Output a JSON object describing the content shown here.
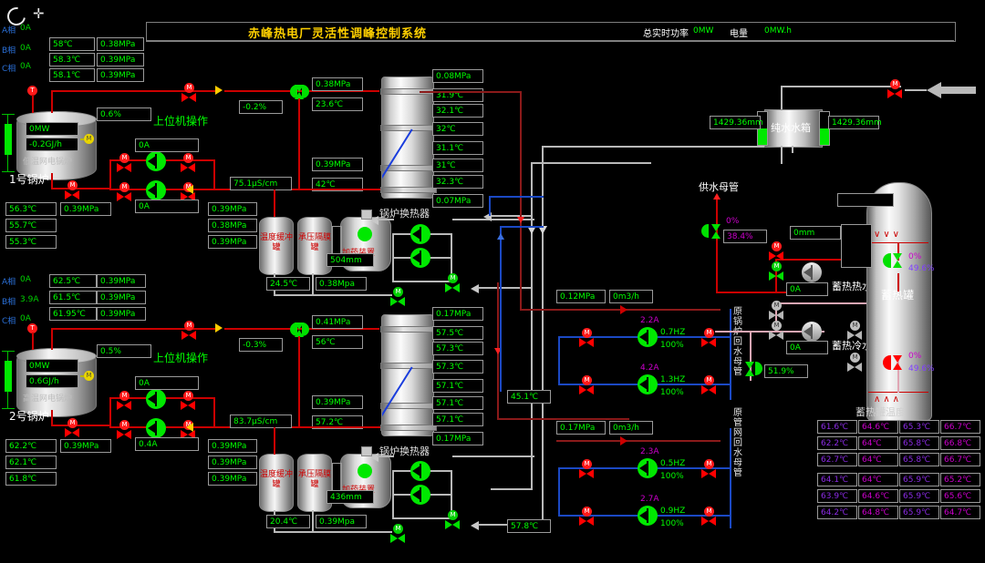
{
  "header": {
    "title": "赤峰热电厂灵活性调峰控制系统",
    "power_label": "总实时功率",
    "power_value": "0MW",
    "energy_label": "电量",
    "energy_value": "0MW.h"
  },
  "cursor": {
    "refresh_icon": "refresh-cursor",
    "move_icon": "move-cursor"
  },
  "boiler1": {
    "name": "1号锅炉",
    "type_label": "低温网电锅炉",
    "power": "0MW",
    "heat_rate": "-0.2GJ/h",
    "opening": "0.6%",
    "host_label": "上位机操作",
    "phases": [
      {
        "label": "A相",
        "current": "0A"
      },
      {
        "label": "B相",
        "current": "0A"
      },
      {
        "label": "C相",
        "current": "0A"
      }
    ],
    "top_temps": [
      "58℃",
      "58.3℃",
      "58.1℃"
    ],
    "top_press": [
      "0.38MPa",
      "0.39MPa",
      "0.39MPa"
    ],
    "bot_temps": [
      "56.3℃",
      "55.7℃",
      "55.3℃"
    ],
    "bot_press": [
      "0.39MPa"
    ],
    "pump_currents": [
      "0A",
      "0A"
    ]
  },
  "boiler2": {
    "name": "2号锅炉",
    "type_label": "高温网电锅炉",
    "power": "0MW",
    "heat_rate": "0.6GJ/h",
    "opening": "0.5%",
    "host_label": "上位机操作",
    "phases": [
      {
        "label": "A相",
        "current": "0A"
      },
      {
        "label": "B相",
        "current": "3.9A"
      },
      {
        "label": "C相",
        "current": "0A"
      }
    ],
    "top_temps": [
      "62.5℃",
      "61.5℃",
      "61.95℃"
    ],
    "top_press": [
      "0.39MPa",
      "0.39MPa",
      "0.39MPa"
    ],
    "bot_temps": [
      "62.2℃",
      "62.1℃",
      "61.8℃"
    ],
    "bot_press": [
      "0.39MPa"
    ],
    "pump_currents": [
      "0A",
      "0.4A"
    ]
  },
  "loop1": {
    "valve_percent": "-0.2%",
    "supply_press": "0.38MPa",
    "supply_temp": "23.6℃",
    "return_press": "0.39MPa",
    "return_temp": "42℃",
    "conductivity": "75.1μS/cm",
    "side_press": [
      "0.39MPa",
      "0.38MPa",
      "0.39MPa"
    ],
    "buffer_tank": "温度缓冲罐",
    "diaphragm_tank": "承压隔膜罐",
    "dosing_device": "加药装置",
    "level": "504mm",
    "bottom_temp": "24.5℃",
    "bottom_press": "0.38Mpa",
    "exchanger_name": "锅炉换热器",
    "exchanger_top_press": "0.08MPa",
    "exchanger_temps": [
      "31.9℃",
      "32.1℃",
      "32℃",
      "31.1℃",
      "31℃",
      "32.3℃"
    ],
    "exchanger_bot_press": "0.07MPa"
  },
  "loop2": {
    "valve_percent": "-0.3%",
    "supply_press": "0.41MPa",
    "supply_temp": "56℃",
    "return_press": "0.39MPa",
    "return_temp": "57.2℃",
    "conductivity": "83.7μS/cm",
    "side_press": [
      "0.39MPa",
      "0.39MPa",
      "0.39MPa"
    ],
    "buffer_tank": "温度缓冲罐",
    "diaphragm_tank": "承压隔膜罐",
    "dosing_device": "加药装置",
    "level": "436mm",
    "bottom_temp": "20.4℃",
    "bottom_press": "0.39Mpa",
    "exchanger_name": "锅炉换热器",
    "exchanger_top_press": "0.17MPa",
    "exchanger_temps": [
      "57.5℃",
      "57.3℃",
      "57.3℃",
      "57.1℃",
      "57.1℃",
      "57.1℃"
    ],
    "exchanger_bot_press": "0.17MPa"
  },
  "mid_temps": {
    "upper": "45.1℃",
    "lower": "57.8℃"
  },
  "circuit_upper": {
    "main_label": "原锅炉回水母管",
    "press": "0.12MPa",
    "flow": "0m3/h",
    "pumps": [
      {
        "current": "2.2A",
        "freq": "0.7HZ",
        "speed": "100%"
      },
      {
        "current": "4.2A",
        "freq": "1.3HZ",
        "speed": "100%"
      }
    ]
  },
  "circuit_lower": {
    "main_label": "原管网回水母管",
    "press": "0.17MPa",
    "flow": "0m3/h",
    "pumps": [
      {
        "current": "2.3A",
        "freq": "0.5HZ",
        "speed": "100%"
      },
      {
        "current": "2.7A",
        "freq": "0.9HZ",
        "speed": "100%"
      }
    ]
  },
  "water_tank": {
    "name": "纯水水箱",
    "level_left": "1429.36mm",
    "level_right": "1429.36mm"
  },
  "supply_main": {
    "label": "供水母管",
    "valve_open": "0%",
    "valve_feedback": "38.4%"
  },
  "storage": {
    "tank_name": "蓄热罐",
    "level": "0mm",
    "hot_pump_label": "蓄热热水泵",
    "hot_pump_current": "0A",
    "cold_pump_label": "蓄热冷水泵",
    "cold_pump_current": "0A",
    "top_valve_open": "0%",
    "top_valve_feedback": "49.6%",
    "bot_valve_open": "0%",
    "bot_valve_feedback": "49.6%",
    "side_valve_feedback": "51.9%",
    "temp_title": "蓄热罐温度",
    "temps": [
      [
        "61.6℃",
        "64.6℃",
        "65.3℃",
        "66.7℃"
      ],
      [
        "62.2℃",
        "64℃",
        "65.8℃",
        "66.8℃"
      ],
      [
        "62.7℃",
        "64℃",
        "65.8℃",
        "66.7℃"
      ],
      [
        "64.1℃",
        "64℃",
        "65.9℃",
        "65.2℃"
      ],
      [
        "63.9℃",
        "64.6℃",
        "65.9℃",
        "65.6℃"
      ],
      [
        "64.2℃",
        "64.8℃",
        "65.9℃",
        "64.7℃"
      ]
    ]
  },
  "colors": {
    "hot_pipe": "#cc0000",
    "cold_pipe": "#1b49c4",
    "neutral_pipe": "#b9b9b9",
    "accent_title": "#ffd000",
    "value_green": "#00ff00",
    "value_magenta": "#cc00cc",
    "value_violet": "#7f5fff"
  }
}
